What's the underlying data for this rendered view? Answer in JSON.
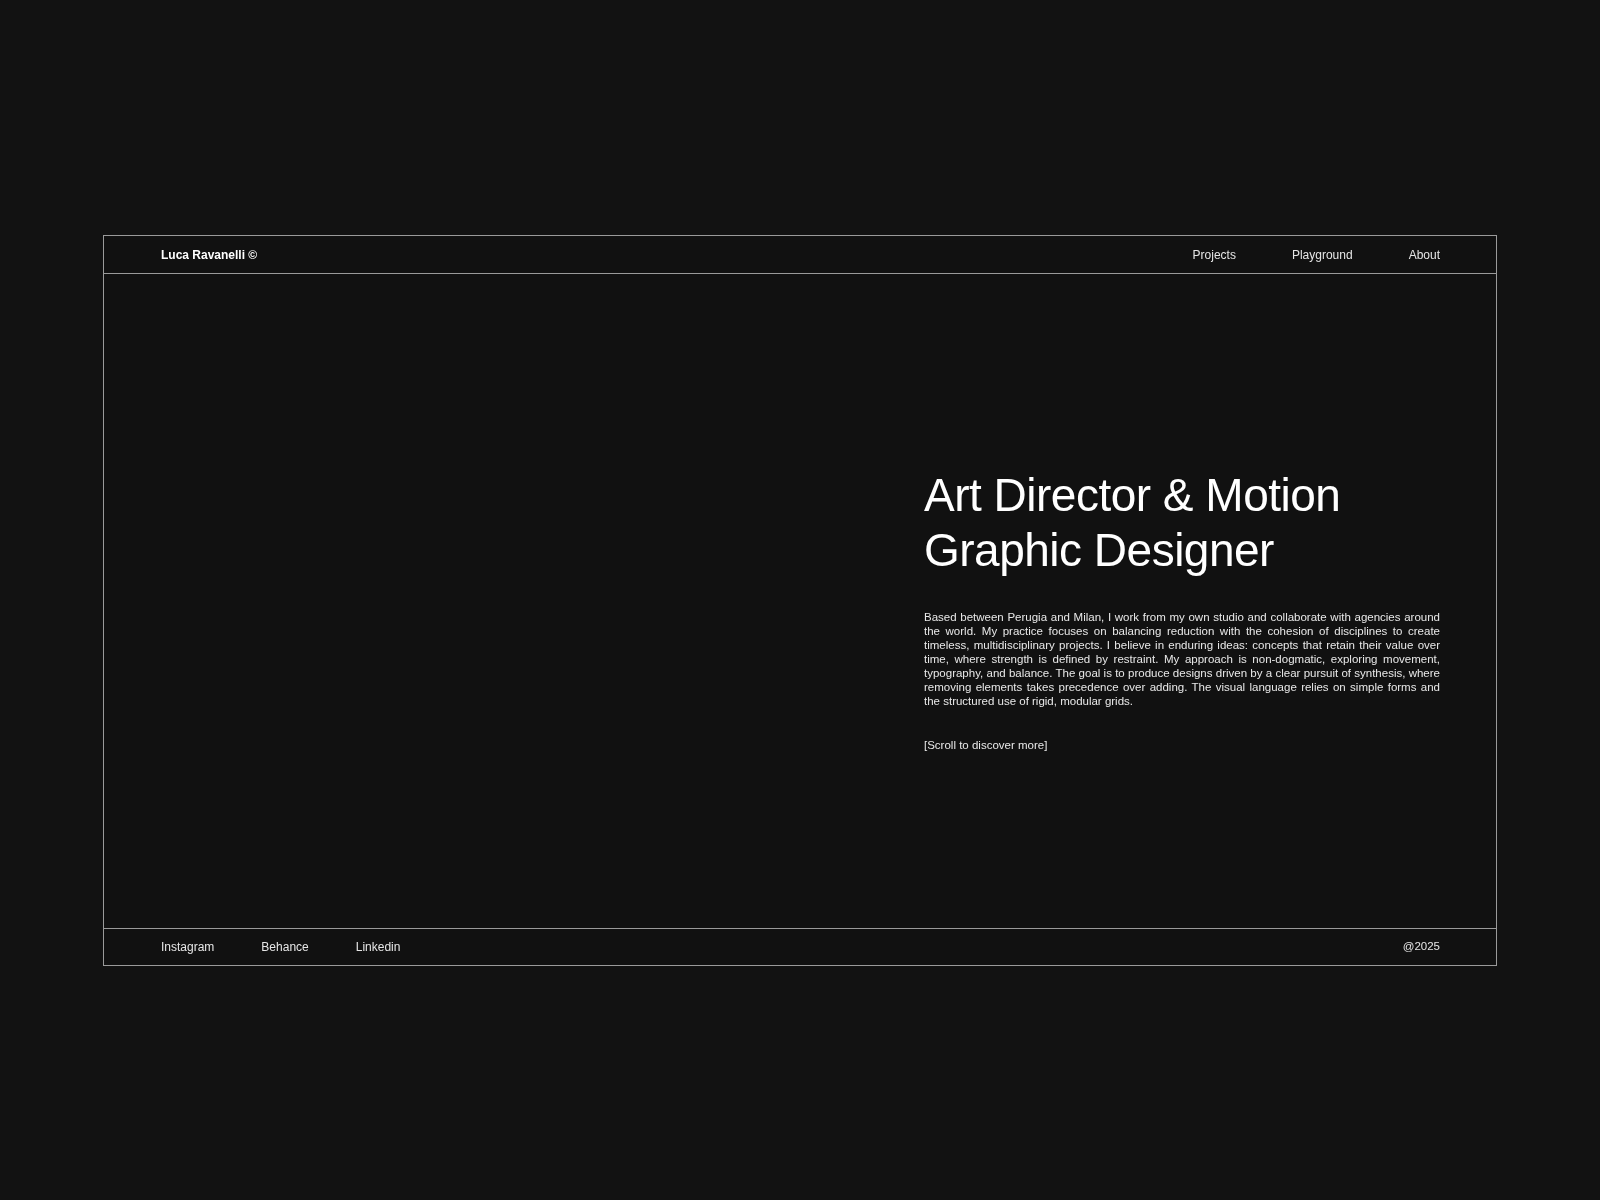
{
  "header": {
    "brand": "Luca Ravanelli ©",
    "nav": [
      "Projects",
      "Playground",
      "About"
    ]
  },
  "hero": {
    "title": "Art Director & Motion Graphic Designer",
    "body": "Based between Perugia and Milan, I work from my own studio and collaborate with agencies around the world. My practice focuses on balancing reduction with the cohesion of disciplines to create timeless, multidisciplinary projects. I believe in enduring ideas: concepts that retain their value over time, where strength is defined by restraint. My approach is non-dogmatic, exploring movement, typography, and balance. The goal is to produce designs driven by a clear pursuit of synthesis, where removing elements takes precedence over adding. The visual language relies on simple forms and the structured use of rigid, modular grids.",
    "scroll_hint": "[Scroll to discover more]"
  },
  "footer": {
    "links": [
      "Instagram",
      "Behance",
      "Linkedin"
    ],
    "copyright": "@2025"
  }
}
